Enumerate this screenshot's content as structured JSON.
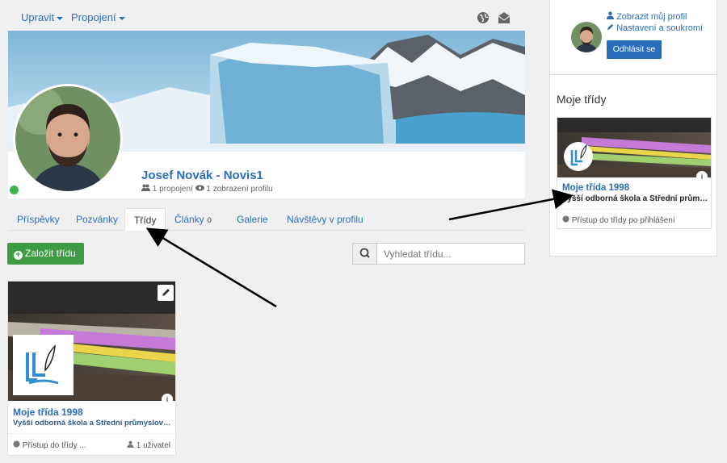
{
  "topbar": {
    "menus": [
      {
        "label": "Upravit"
      },
      {
        "label": "Propojení"
      }
    ],
    "icons": [
      "globe-icon",
      "envelope-icon"
    ]
  },
  "profile": {
    "name": "Josef Novák - Novis1",
    "connections": "1 propojení",
    "views": "1 zobrazení profilu",
    "status_color": "#3bb54a"
  },
  "tabs": [
    {
      "label": "Příspěvky"
    },
    {
      "label": "Pozvánky"
    },
    {
      "label": "Třídy",
      "active": true
    },
    {
      "label": "Články",
      "count": "0"
    },
    {
      "label": "Galerie"
    },
    {
      "label": "Návštěvy v profilu"
    }
  ],
  "actions": {
    "add_class_label": "Založit třídu",
    "search_placeholder": "Vyhledat třídu..."
  },
  "class_card": {
    "title": "Moje třída 1998",
    "school": "Vyšší odborná škola a Střední průmyslová škola",
    "access": "Přístup do třídy ...",
    "users": "1 uživatel"
  },
  "sidebar": {
    "view_profile": "Zobrazit můj profil",
    "settings": "Nastavení a soukromí",
    "logout": "Odhlásit se",
    "heading": "Moje třídy",
    "card": {
      "title": "Moje třída 1998",
      "school": "Vyšší odborná škola a Střední průmyslová škola",
      "access": "Přístup do třídy po přihlášení"
    }
  },
  "colors": {
    "link": "#2a6ebb",
    "add_button": "#3c9b43",
    "logout_button": "#2a6ebb"
  }
}
